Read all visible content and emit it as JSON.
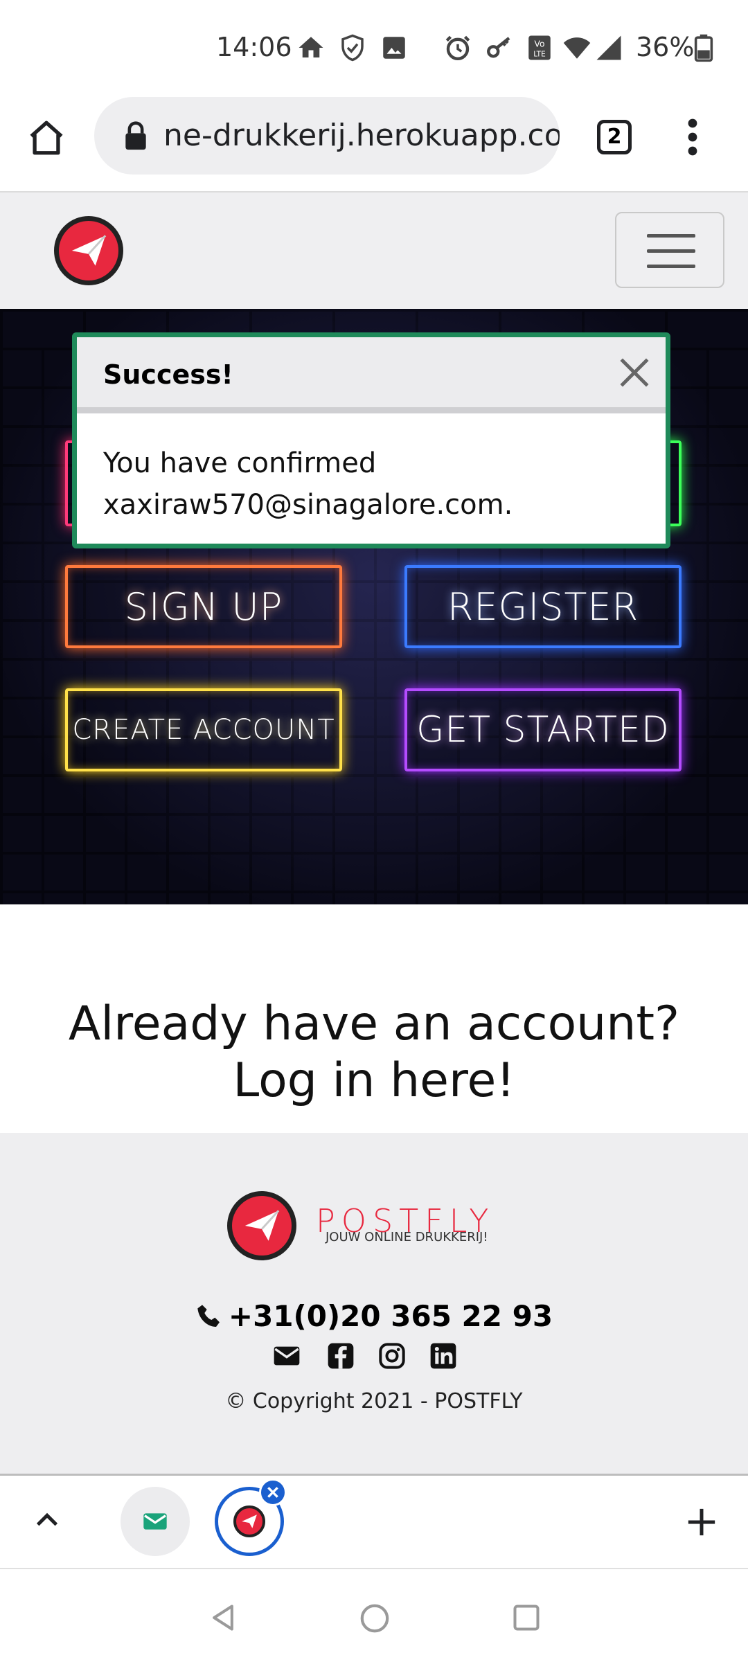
{
  "status_bar": {
    "time": "14:06",
    "battery": "36%",
    "icons": [
      "home-icon",
      "shield-icon",
      "image-icon",
      "alarm-icon",
      "key-icon",
      "volte-icon",
      "wifi-icon",
      "signal-icon",
      "battery-icon"
    ]
  },
  "browser": {
    "url": "ne-drukkerij.herokuapp.com",
    "tab_count": "2"
  },
  "toast": {
    "title": "Success!",
    "message_line1": "You have confirmed",
    "message_line2": "xaxiraw570@sinagalore.com.",
    "accent_color": "#1f8a5a"
  },
  "hero": {
    "buttons": [
      {
        "label": "SIGN UP",
        "color": "#ff7a3d"
      },
      {
        "label": "REGISTER",
        "color": "#3b7bff"
      },
      {
        "label": "CREATE ACCOUNT",
        "color": "#ffe14a"
      },
      {
        "label": "GET STARTED",
        "color": "#b54cff"
      }
    ]
  },
  "login": {
    "line1": "Already have an account?",
    "line2": "Log in here!"
  },
  "footer": {
    "brand_name": "POSTFLY",
    "brand_tagline": "JOUW ONLINE DRUKKERIJ!",
    "phone": "+31(0)20 365 22 93",
    "copyright": "© Copyright 2021 - POSTFLY",
    "social": [
      "envelope-icon",
      "facebook-icon",
      "instagram-icon",
      "linkedin-icon"
    ]
  },
  "colors": {
    "brand_red": "#e8283f"
  }
}
